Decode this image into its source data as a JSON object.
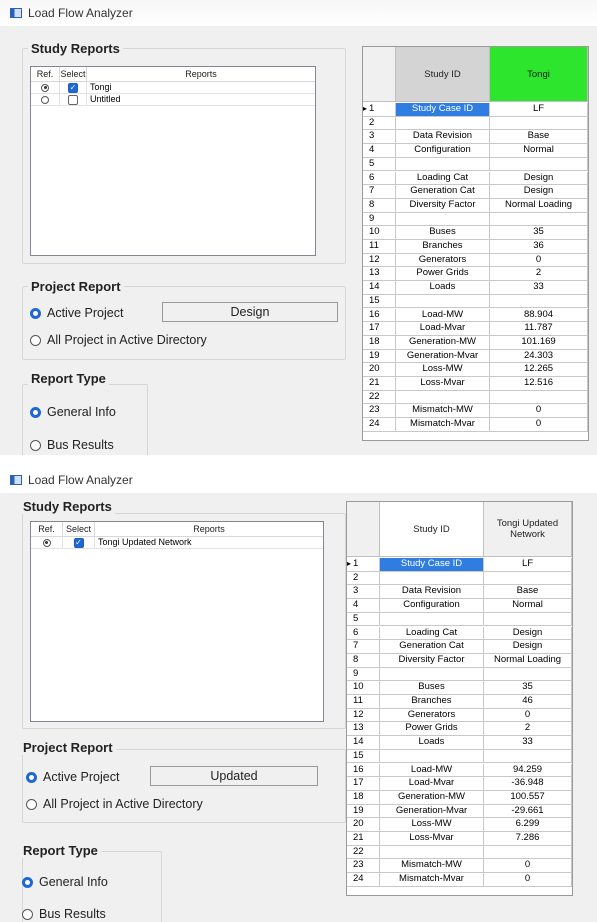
{
  "windows": [
    {
      "title": "Load Flow Analyzer",
      "study_reports": {
        "title": "Study Reports",
        "columns": [
          "Ref.",
          "Select",
          "Reports"
        ],
        "rows": [
          {
            "ref": true,
            "select": true,
            "name": "Tongi"
          },
          {
            "ref": false,
            "select": false,
            "name": "Untitled"
          }
        ]
      },
      "project_report": {
        "title": "Project Report",
        "active_label": "Active Project",
        "active_value": "Design",
        "all_label": "All Project in Active Directory"
      },
      "report_type": {
        "title": "Report Type",
        "general_label": "General Info",
        "bus_label": "Bus Results"
      },
      "grid": {
        "header_label": "Study ID",
        "header_value": "Tongi",
        "header_color": "#2ee52e",
        "rows": [
          {
            "n": "1",
            "label": "Study Case ID",
            "value": "LF"
          },
          {
            "n": "2",
            "label": "",
            "value": ""
          },
          {
            "n": "3",
            "label": "Data Revision",
            "value": "Base"
          },
          {
            "n": "4",
            "label": "Configuration",
            "value": "Normal"
          },
          {
            "n": "5",
            "label": "",
            "value": ""
          },
          {
            "n": "6",
            "label": "Loading Cat",
            "value": "Design"
          },
          {
            "n": "7",
            "label": "Generation Cat",
            "value": "Design"
          },
          {
            "n": "8",
            "label": "Diversity Factor",
            "value": "Normal Loading"
          },
          {
            "n": "9",
            "label": "",
            "value": ""
          },
          {
            "n": "10",
            "label": "Buses",
            "value": "35"
          },
          {
            "n": "11",
            "label": "Branches",
            "value": "36"
          },
          {
            "n": "12",
            "label": "Generators",
            "value": "0"
          },
          {
            "n": "13",
            "label": "Power Grids",
            "value": "2"
          },
          {
            "n": "14",
            "label": "Loads",
            "value": "33"
          },
          {
            "n": "15",
            "label": "",
            "value": ""
          },
          {
            "n": "16",
            "label": "Load-MW",
            "value": "88.904"
          },
          {
            "n": "17",
            "label": "Load-Mvar",
            "value": "11.787"
          },
          {
            "n": "18",
            "label": "Generation-MW",
            "value": "101.169"
          },
          {
            "n": "19",
            "label": "Generation-Mvar",
            "value": "24.303"
          },
          {
            "n": "20",
            "label": "Loss-MW",
            "value": "12.265"
          },
          {
            "n": "21",
            "label": "Loss-Mvar",
            "value": "12.516"
          },
          {
            "n": "22",
            "label": "",
            "value": ""
          },
          {
            "n": "23",
            "label": "Mismatch-MW",
            "value": "0"
          },
          {
            "n": "24",
            "label": "Mismatch-Mvar",
            "value": "0"
          }
        ]
      }
    },
    {
      "title": "Load Flow Analyzer",
      "study_reports": {
        "title": "Study Reports",
        "columns": [
          "Ref.",
          "Select",
          "Reports"
        ],
        "rows": [
          {
            "ref": true,
            "select": true,
            "name": "Tongi Updated Network"
          }
        ]
      },
      "project_report": {
        "title": "Project Report",
        "active_label": "Active Project",
        "active_value": "Updated",
        "all_label": "All Project in Active Directory"
      },
      "report_type": {
        "title": "Report Type",
        "general_label": "General Info",
        "bus_label": "Bus Results"
      },
      "grid": {
        "header_label": "Study ID",
        "header_value": "Tongi Updated Network",
        "header_color": "#f0f0f0",
        "rows": [
          {
            "n": "1",
            "label": "Study Case ID",
            "value": "LF"
          },
          {
            "n": "2",
            "label": "",
            "value": ""
          },
          {
            "n": "3",
            "label": "Data Revision",
            "value": "Base"
          },
          {
            "n": "4",
            "label": "Configuration",
            "value": "Normal"
          },
          {
            "n": "5",
            "label": "",
            "value": ""
          },
          {
            "n": "6",
            "label": "Loading Cat",
            "value": "Design"
          },
          {
            "n": "7",
            "label": "Generation Cat",
            "value": "Design"
          },
          {
            "n": "8",
            "label": "Diversity Factor",
            "value": "Normal Loading"
          },
          {
            "n": "9",
            "label": "",
            "value": ""
          },
          {
            "n": "10",
            "label": "Buses",
            "value": "35"
          },
          {
            "n": "11",
            "label": "Branches",
            "value": "46"
          },
          {
            "n": "12",
            "label": "Generators",
            "value": "0"
          },
          {
            "n": "13",
            "label": "Power Grids",
            "value": "2"
          },
          {
            "n": "14",
            "label": "Loads",
            "value": "33"
          },
          {
            "n": "15",
            "label": "",
            "value": ""
          },
          {
            "n": "16",
            "label": "Load-MW",
            "value": "94.259"
          },
          {
            "n": "17",
            "label": "Load-Mvar",
            "value": "-36.948"
          },
          {
            "n": "18",
            "label": "Generation-MW",
            "value": "100.557"
          },
          {
            "n": "19",
            "label": "Generation-Mvar",
            "value": "-29.661"
          },
          {
            "n": "20",
            "label": "Loss-MW",
            "value": "6.299"
          },
          {
            "n": "21",
            "label": "Loss-Mvar",
            "value": "7.286"
          },
          {
            "n": "22",
            "label": "",
            "value": ""
          },
          {
            "n": "23",
            "label": "Mismatch-MW",
            "value": "0"
          },
          {
            "n": "24",
            "label": "Mismatch-Mvar",
            "value": "0"
          }
        ]
      }
    }
  ],
  "colors": {
    "selected_cell": "#2f7de1",
    "radio_accent": "#1e67d4",
    "window_bg": "#f0f0f0"
  }
}
